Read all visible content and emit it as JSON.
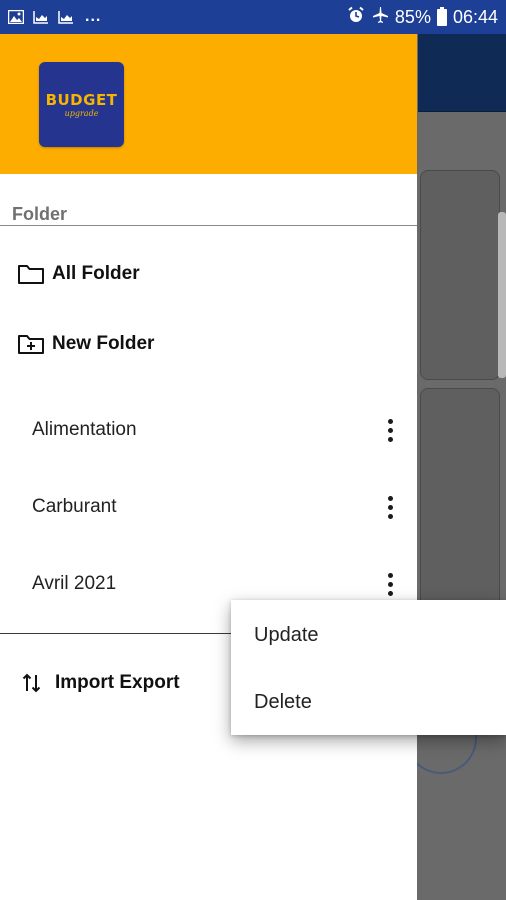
{
  "status_bar": {
    "battery_percent": "85%",
    "time": "06:44",
    "notifications_overflow": "...",
    "left_icons": [
      "gallery-icon",
      "chart-icon",
      "chart-icon"
    ],
    "right_icons": [
      "alarm-icon",
      "airplane-icon",
      "battery-icon"
    ]
  },
  "drawer": {
    "logo": {
      "title": "BUDGET",
      "subtitle": "upgrade"
    },
    "section_label": "Folder",
    "nav": {
      "all_folder": "All Folder",
      "new_folder": "New Folder",
      "import_export": "Import Export"
    },
    "folders": [
      {
        "name": "Alimentation"
      },
      {
        "name": "Carburant"
      },
      {
        "name": "Avril 2021"
      }
    ]
  },
  "popup_menu": {
    "update": "Update",
    "delete": "Delete"
  },
  "colors": {
    "status_bar": "#1d3f96",
    "header": "#fdad00",
    "logo_bg": "#25358f",
    "logo_text": "#f7b500",
    "scrim": "#6b6b6b",
    "app_bar_behind": "#0f2a55"
  }
}
